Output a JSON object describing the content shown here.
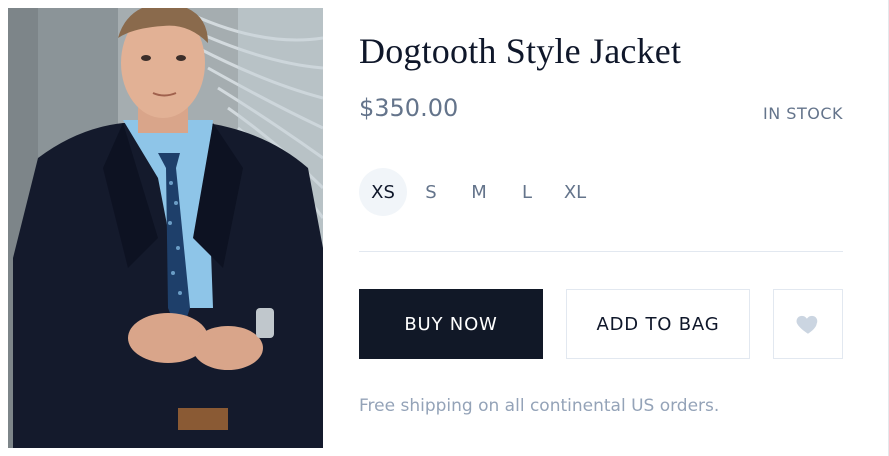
{
  "product": {
    "title": "Dogtooth Style Jacket",
    "price": "$350.00",
    "stock_status": "IN STOCK",
    "image_alt": "man-in-navy-suit-photo"
  },
  "sizes": {
    "options": [
      "XS",
      "S",
      "M",
      "L",
      "XL"
    ],
    "selected": "XS"
  },
  "actions": {
    "buy_label": "BUY NOW",
    "bag_label": "ADD TO BAG",
    "favorite_icon": "heart-icon"
  },
  "footer": {
    "shipping_note": "Free shipping on all continental US orders."
  },
  "colors": {
    "primary": "#111827",
    "muted": "#64748b",
    "border": "#e2e8f0",
    "note": "#94a3b8",
    "heart": "#cbd5e1"
  }
}
